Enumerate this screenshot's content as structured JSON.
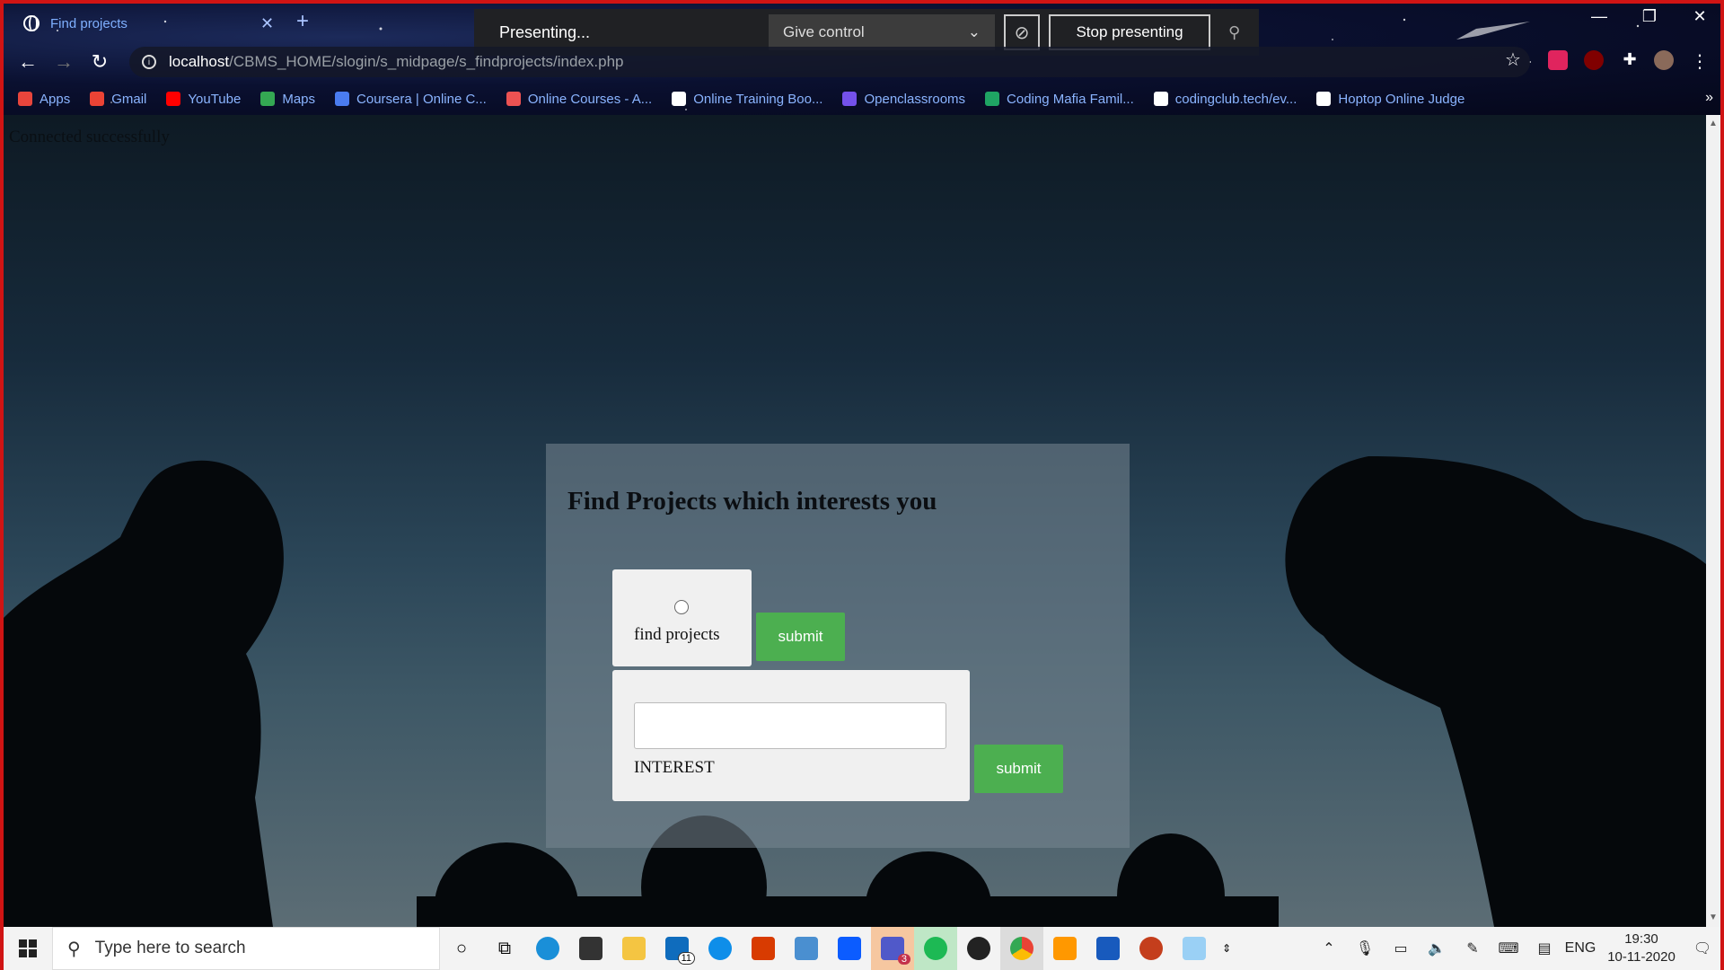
{
  "browser": {
    "tab_title": "Find projects",
    "url_host": "localhost",
    "url_path": "/CBMS_HOME/slogin/s_midpage/s_findprojects/index.php",
    "presenting_label": "Presenting...",
    "give_control_label": "Give control",
    "stop_presenting_label": "Stop presenting",
    "bookmarks": [
      {
        "label": "Apps",
        "icon": "apps-grid-icon",
        "color": "#e8453c"
      },
      {
        "label": "Gmail",
        "icon": "gmail-icon",
        "color": "#ea4335"
      },
      {
        "label": "YouTube",
        "icon": "youtube-icon",
        "color": "#ff0000"
      },
      {
        "label": "Maps",
        "icon": "maps-icon",
        "color": "#34a853"
      },
      {
        "label": "Coursera | Online C...",
        "icon": "coursera-icon",
        "color": "#4a7cf0"
      },
      {
        "label": "Online Courses - A...",
        "icon": "udemy-icon",
        "color": "#ec5252"
      },
      {
        "label": "Online Training Boo...",
        "icon": "bulb-icon",
        "color": "#ffffff"
      },
      {
        "label": "Openclassrooms",
        "icon": "openclassrooms-icon",
        "color": "#7451eb"
      },
      {
        "label": "Coding Mafia Famil...",
        "icon": "plus-icon",
        "color": "#1fa463"
      },
      {
        "label": "codingclub.tech/ev...",
        "icon": "bulb-icon",
        "color": "#ffffff"
      },
      {
        "label": "Hoptop Online Judge",
        "icon": "globe-icon",
        "color": "#ffffff"
      }
    ]
  },
  "page": {
    "connection_message": "Connected successfully",
    "heading": "Find Projects which interests you",
    "radio_label": "find projects",
    "submit_label_1": "submit",
    "interest_label": "INTEREST",
    "interest_value": "",
    "submit_label_2": "submit"
  },
  "taskbar": {
    "search_placeholder": "Type here to search",
    "language": "ENG",
    "time": "19:30",
    "date": "10-11-2020",
    "mail_badge": "11",
    "teams_badge": "3"
  },
  "colors": {
    "submit_button": "#4caf50",
    "presenting_bar": "#202124",
    "window_border": "#d01414"
  }
}
